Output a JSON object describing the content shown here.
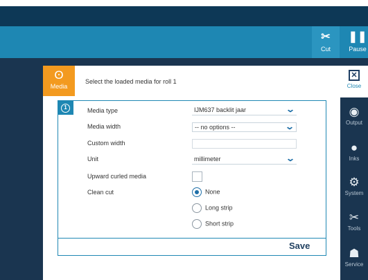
{
  "toolbar": {
    "cut": {
      "label": "Cut",
      "icon": "scissors-icon"
    },
    "pause": {
      "label": "Pause",
      "icon": "pause-icon"
    }
  },
  "media_tab": {
    "label": "Media",
    "icon": "media-roll-icon"
  },
  "dialog": {
    "header": "Select the loaded media for roll 1",
    "step": "1",
    "save_label": "Save"
  },
  "form": {
    "media_type": {
      "label": "Media type",
      "value": "IJM637 backlit jaar"
    },
    "media_width": {
      "label": "Media width",
      "value": "-- no options --"
    },
    "custom_width": {
      "label": "Custom width",
      "value": ""
    },
    "unit": {
      "label": "Unit",
      "value": "millimeter"
    },
    "upward_curled": {
      "label": "Upward curled media",
      "checked": false
    },
    "clean_cut": {
      "label": "Clean cut",
      "options": [
        "None",
        "Long strip",
        "Short strip"
      ],
      "selected": "None"
    }
  },
  "sidebar": {
    "close": "Close",
    "items": [
      {
        "label": "Output",
        "icon": "output-icon"
      },
      {
        "label": "Inks",
        "icon": "ink-drop-icon"
      },
      {
        "label": "System",
        "icon": "gear-icon"
      },
      {
        "label": "Tools",
        "icon": "tools-icon"
      },
      {
        "label": "Service",
        "icon": "service-icon"
      }
    ]
  },
  "colors": {
    "accent": "#1e87b3",
    "media_tab": "#f39a1f",
    "background": "#1a3550"
  }
}
